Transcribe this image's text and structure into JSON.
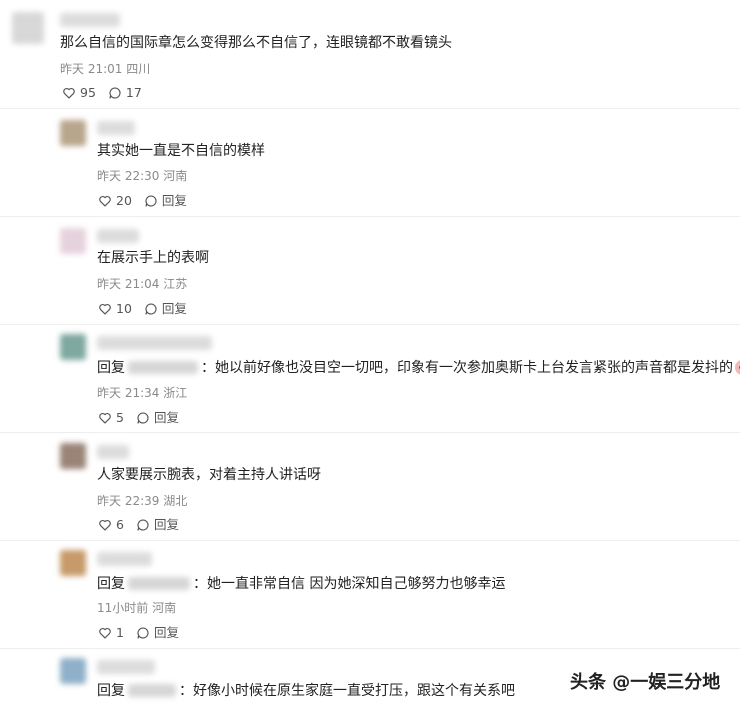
{
  "comments": [
    {
      "text": "那么自信的国际章怎么变得那么不自信了，连眼镜都不敢看镜头",
      "time": "昨天 21:01",
      "location": "四川",
      "likes": "95",
      "replies": "17"
    },
    {
      "text": "其实她一直是不自信的模样",
      "time": "昨天 22:30",
      "location": "河南",
      "likes": "20",
      "reply_label": "回复"
    },
    {
      "text": "在展示手上的表啊",
      "time": "昨天 21:04",
      "location": "江苏",
      "likes": "10",
      "reply_label": "回复"
    },
    {
      "prefix": "回复",
      "text": "：她以前好像也没目空一切吧，印象有一次参加奥斯卡上台发言紧张的声音都是发抖的",
      "time": "昨天 21:34",
      "location": "浙江",
      "likes": "5",
      "reply_label": "回复"
    },
    {
      "text": "人家要展示腕表，对着主持人讲话呀",
      "time": "昨天 22:39",
      "location": "湖北",
      "likes": "6",
      "reply_label": "回复"
    },
    {
      "prefix": "回复",
      "text": "：她一直非常自信 因为她深知自己够努力也够幸运",
      "time": "11小时前",
      "location": "河南",
      "likes": "1",
      "reply_label": "回复"
    },
    {
      "prefix": "回复",
      "text": "：好像小时候在原生家庭一直受打压，跟这个有关系吧"
    }
  ],
  "watermark": "头条 @一娱三分地"
}
